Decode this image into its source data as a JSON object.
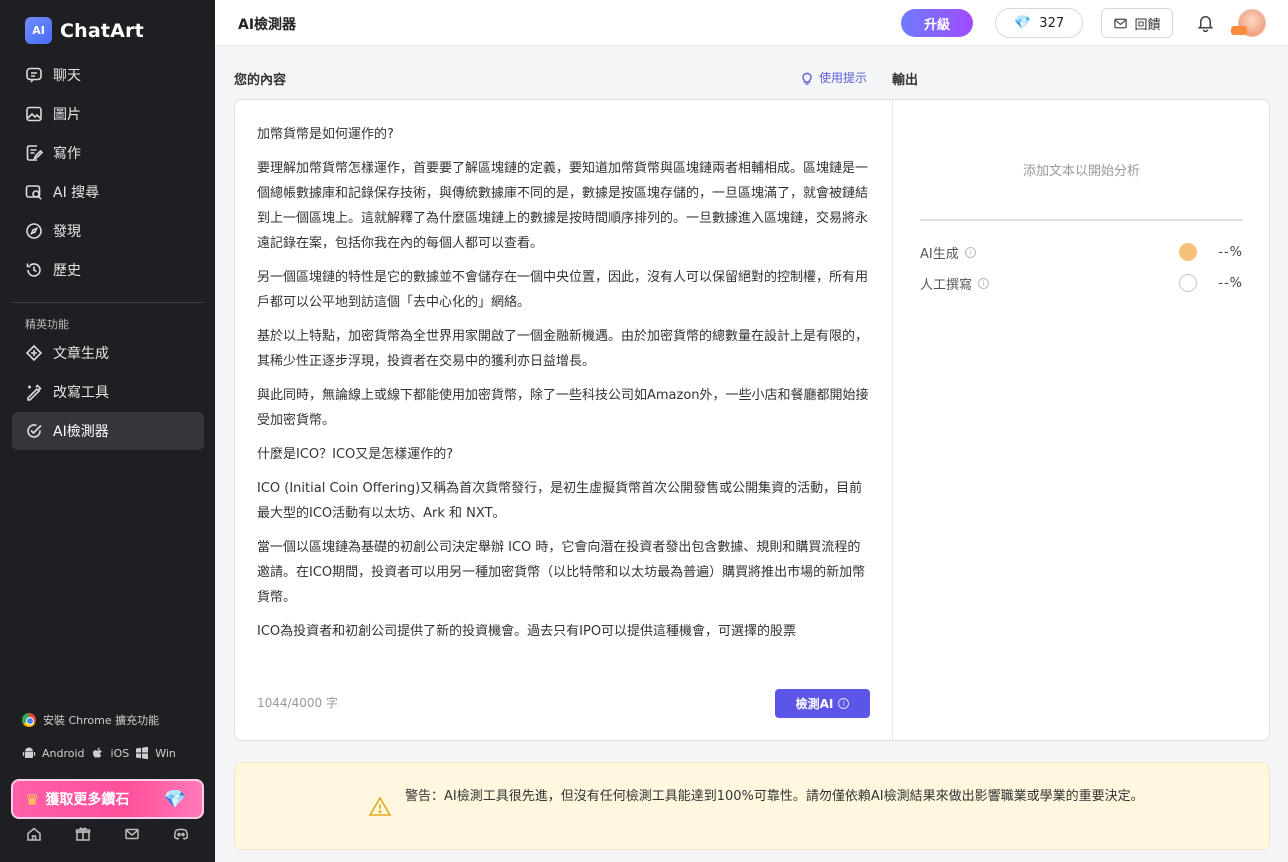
{
  "app": {
    "name": "ChatArt",
    "logo_badge": "AI"
  },
  "sidebar": {
    "items": [
      {
        "label": "聊天",
        "icon": "chat-icon"
      },
      {
        "label": "圖片",
        "icon": "image-icon"
      },
      {
        "label": "寫作",
        "icon": "write-icon"
      },
      {
        "label": "AI 搜尋",
        "icon": "ai-search-icon"
      },
      {
        "label": "發現",
        "icon": "compass-icon"
      },
      {
        "label": "歷史",
        "icon": "history-icon"
      }
    ],
    "section_label": "精英功能",
    "pro_items": [
      {
        "label": "文章生成",
        "icon": "article-icon"
      },
      {
        "label": "改寫工具",
        "icon": "rewrite-icon"
      },
      {
        "label": "AI檢測器",
        "icon": "detector-icon",
        "active": true
      }
    ],
    "extension": "安裝 Chrome 擴充功能",
    "platforms": [
      "Android",
      "iOS",
      "Win"
    ],
    "promo": "獲取更多鑽石"
  },
  "topbar": {
    "title": "AI檢測器",
    "upgrade": "升級",
    "gems": "327",
    "feedback": "回饋"
  },
  "input_panel": {
    "label": "您的內容",
    "tips": "使用提示",
    "paragraphs": [
      "加幣貨幣是如何運作的?",
      "要理解加幣貨幣怎樣運作，首要要了解區塊鏈的定義，要知道加幣貨幣與區塊鏈兩者相輔相成。區塊鏈是一個總帳數據庫和記錄保存技術，與傳統數據庫不同的是，數據是按區塊存儲的，一旦區塊滿了，就會被鏈結到上一個區塊上。這就解釋了為什麼區塊鏈上的數據是按時間順序排列的。一旦數據進入區塊鏈，交易將永遠記錄在案，包括你我在內的每個人都可以查看。",
      "另一個區塊鏈的特性是它的數據並不會儲存在一個中央位置，因此，沒有人可以保留絕對的控制權，所有用戶都可以公平地到訪這個「去中心化的」網絡。",
      "基於以上特點，加密貨幣為全世界用家開啟了一個金融新機遇。由於加密貨幣的總數量在設計上是有限的，其稀少性正逐步浮現，投資者在交易中的獲利亦日益增長。",
      "與此同時，無論線上或線下都能使用加密貨幣，除了一些科技公司如Amazon外，一些小店和餐廳都開始接受加密貨幣。",
      "什麼是ICO？ICO又是怎樣運作的?",
      "ICO (Initial Coin Offering)又稱為首次貨幣發行，是初生虛擬貨幣首次公開發售或公開集資的活動，目前最大型的ICO活動有以太坊、Ark 和 NXT。",
      "當一個以區塊鏈為基礎的初創公司決定舉辦 ICO 時，它會向潛在投資者發出包含數據、規則和購買流程的邀請。在ICO期間，投資者可以用另一種加密貨幣（以比特幣和以太坊最為普遍）購買將推出市場的新加幣貨幣。",
      "ICO為投資者和初創公司提供了新的投資機會。過去只有IPO可以提供這種機會，可選擇的股票"
    ],
    "char_count": "1044/4000 字",
    "detect_button": "檢測AI"
  },
  "output_panel": {
    "label": "輸出",
    "placeholder": "添加文本以開始分析",
    "rows": [
      {
        "label": "AI生成",
        "value": "--%",
        "color": "#f5c07a"
      },
      {
        "label": "人工撰寫",
        "value": "--%",
        "color": "#ffffff"
      }
    ]
  },
  "warning": {
    "text": "警告：AI檢測工具很先進，但沒有任何檢測工具能達到100%可靠性。請勿僅依賴AI檢測結果來做出影響職業或學業的重要決定。"
  }
}
